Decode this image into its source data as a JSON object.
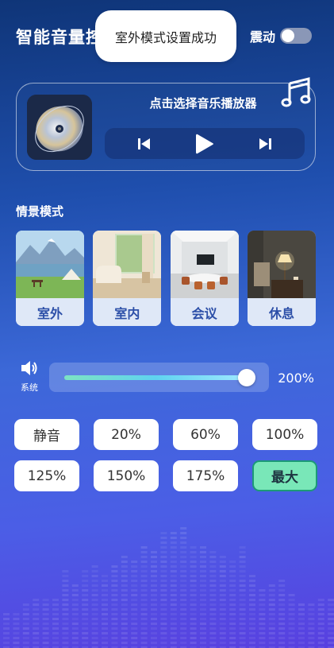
{
  "header": {
    "app_title": "智能音量控",
    "vibrate_label": "震动",
    "vibrate_on": false
  },
  "toast": {
    "message": "室外模式设置成功"
  },
  "player": {
    "title": "点击选择音乐播放器",
    "icons": [
      "album-art-icon",
      "music-note-icon",
      "previous-icon",
      "play-icon",
      "next-icon"
    ]
  },
  "scenes": {
    "label": "情景模式",
    "items": [
      {
        "label": "室外",
        "image": "outdoor-lake-tent"
      },
      {
        "label": "室内",
        "image": "indoor-lounge"
      },
      {
        "label": "会议",
        "image": "meeting-room"
      },
      {
        "label": "休息",
        "image": "bedroom-lamp"
      }
    ]
  },
  "volume": {
    "icon": "speaker-icon",
    "label": "系统",
    "level": 1.0,
    "value_text": "200%"
  },
  "presets": {
    "items": [
      {
        "label": "静音",
        "active": false
      },
      {
        "label": "20%",
        "active": false
      },
      {
        "label": "60%",
        "active": false
      },
      {
        "label": "100%",
        "active": false
      },
      {
        "label": "125%",
        "active": false
      },
      {
        "label": "150%",
        "active": false
      },
      {
        "label": "175%",
        "active": false
      },
      {
        "label": "最大",
        "active": true
      }
    ]
  },
  "colors": {
    "background_top": "#0f3578",
    "background_bottom": "#5840e0",
    "accent_green": "#79e7b8",
    "scene_label": "#2c4fa8"
  }
}
